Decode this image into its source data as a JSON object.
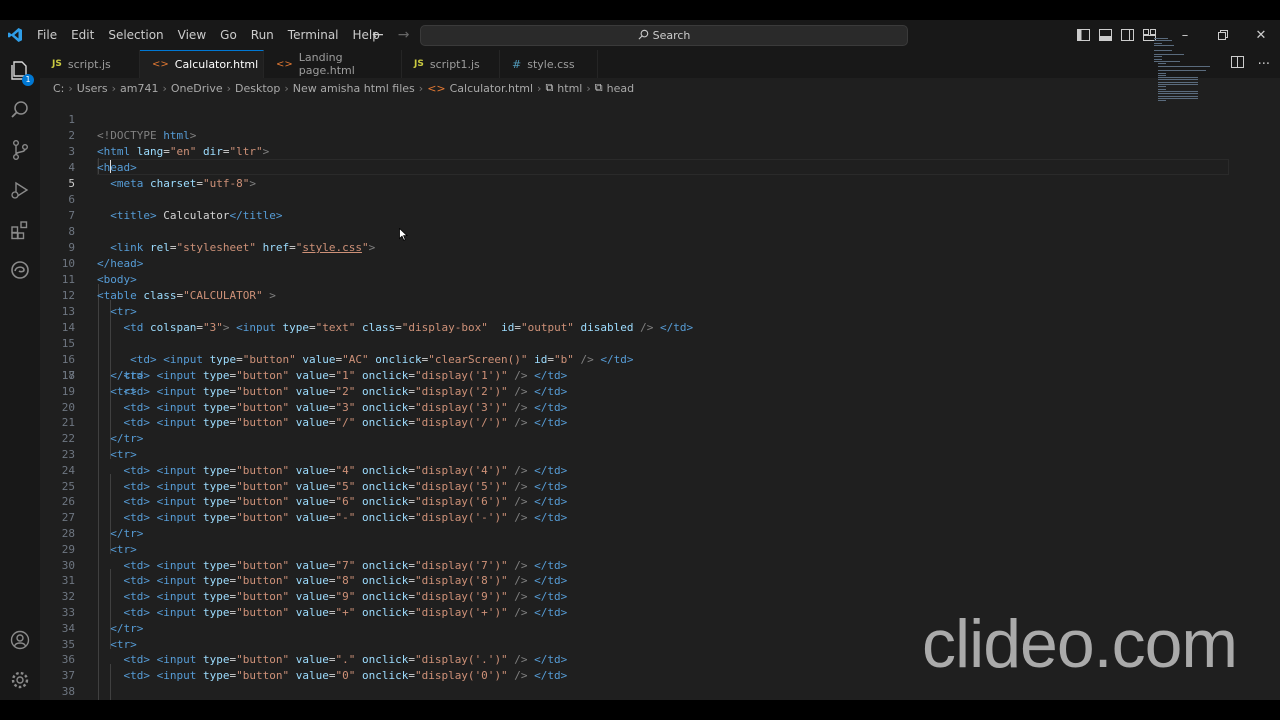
{
  "menu": [
    "File",
    "Edit",
    "Selection",
    "View",
    "Go",
    "Run",
    "Terminal",
    "Help"
  ],
  "search_label": "Search",
  "tabs": [
    {
      "label": "script.js",
      "icon": "JS"
    },
    {
      "label": "Calculator.html",
      "icon": "<>"
    },
    {
      "label": "Landing page.html",
      "icon": "<>"
    },
    {
      "label": "script1.js",
      "icon": "JS"
    },
    {
      "label": "style.css",
      "icon": "#"
    }
  ],
  "breadcrumb": [
    "C:",
    "Users",
    "am741",
    "OneDrive",
    "Desktop",
    "New amisha html files",
    "Calculator.html",
    "html",
    "head"
  ],
  "line_numbers": [
    "1",
    "2",
    "3",
    "4",
    "5",
    "6",
    "7",
    "8",
    "9",
    "10",
    "11",
    "12",
    "13",
    "14",
    "15",
    "16",
    "17",
    "18",
    "19",
    "20",
    "21",
    "22",
    "23",
    "24",
    "25",
    "26",
    "27",
    "28",
    "29",
    "30",
    "31",
    "32",
    "33",
    "34",
    "35",
    "36",
    "37",
    "38"
  ],
  "code": {
    "l1": [
      "<!DOCTYPE",
      " html",
      ">"
    ],
    "l2": [
      "<html",
      " lang",
      "=",
      "\"en\"",
      " dir",
      "=",
      "\"ltr\"",
      ">"
    ],
    "l3": [
      "<head>"
    ],
    "l4": [
      "<meta",
      " charset",
      "=",
      "\"utf-8\"",
      ">"
    ],
    "l6": [
      "<title>",
      " Calculator",
      "</title>"
    ],
    "l8": [
      "<link",
      " rel",
      "=",
      "\"stylesheet\"",
      " href",
      "=",
      "\"",
      "style.css",
      "\"",
      ">"
    ],
    "l9": [
      "</head>"
    ],
    "l10": [
      "<body>"
    ],
    "l11": [
      "<table",
      " class",
      "=",
      "\"CALCULATOR\"",
      " >"
    ],
    "tr_open": "<tr>",
    "tr_close": "</tr>",
    "l13": [
      "<td",
      " colspan",
      "=",
      "\"3\"",
      "> ",
      "<input",
      " type",
      "=",
      "\"text\"",
      " class",
      "=",
      "\"display-box\"",
      "  id",
      "=",
      "\"output\"",
      " disabled",
      " />",
      " </td>"
    ],
    "l15": [
      "<td>",
      " <input",
      " type",
      "=",
      "\"button\"",
      " value",
      "=",
      "\"AC\"",
      " onclick",
      "=",
      "\"clearScreen()\"",
      " id",
      "=",
      "\"b\"",
      " />",
      " </td>"
    ],
    "buttons": [
      {
        "v": "1",
        "arg": "'1'"
      },
      {
        "v": "2",
        "arg": "'2'"
      },
      {
        "v": "3",
        "arg": "'3'"
      },
      {
        "v": "/",
        "arg": "'/'"
      },
      {
        "v": "4",
        "arg": "'4'"
      },
      {
        "v": "5",
        "arg": "'5'"
      },
      {
        "v": "6",
        "arg": "'6'"
      },
      {
        "v": "-",
        "arg": "'-'"
      },
      {
        "v": "7",
        "arg": "'7'"
      },
      {
        "v": "8",
        "arg": "'8'"
      },
      {
        "v": "9",
        "arg": "'9'"
      },
      {
        "v": "+",
        "arg": "'+'"
      },
      {
        "v": ".",
        "arg": "'.'"
      },
      {
        "v": "0",
        "arg": "'0'"
      }
    ]
  },
  "watermark": "clideo.com",
  "colors": {
    "tag": "#569cd6",
    "attr": "#9cdcfe",
    "string": "#ce9178",
    "bracket": "#808080",
    "accent": "#0078d4"
  }
}
